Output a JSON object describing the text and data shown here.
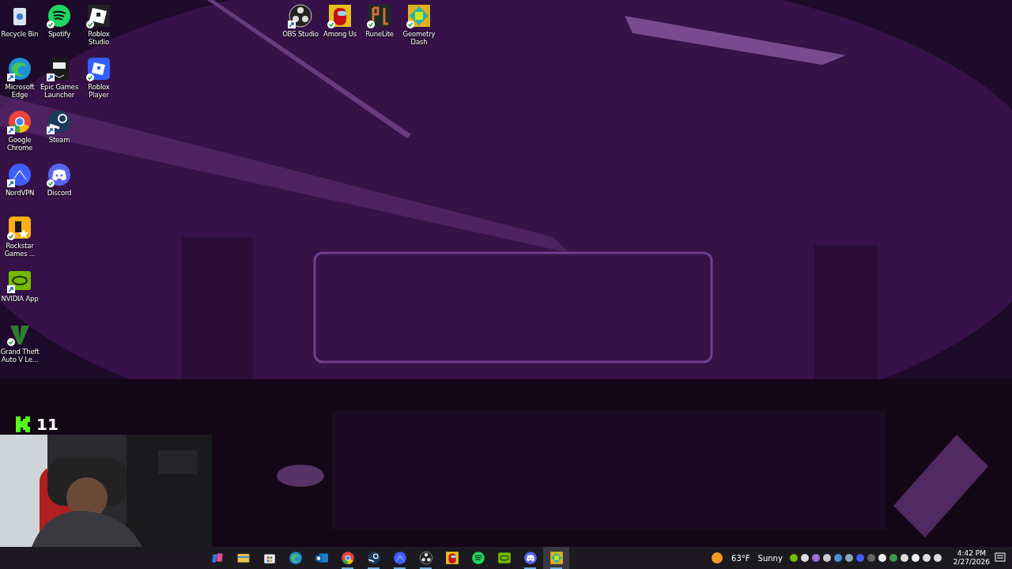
{
  "desktop": {
    "columns": [
      {
        "icons": [
          {
            "kind": "recycle",
            "label": "Recycle Bin",
            "shortcut": false,
            "synced": false
          },
          {
            "kind": "edge",
            "label": "Microsoft Edge",
            "shortcut": true,
            "synced": false
          },
          {
            "kind": "chrome",
            "label": "Google Chrome",
            "shortcut": true,
            "synced": false
          },
          {
            "kind": "nordvpn",
            "label": "NordVPN",
            "shortcut": true,
            "synced": false
          },
          {
            "kind": "rockstar",
            "label": "Rockstar Games ...",
            "shortcut": false,
            "synced": true
          },
          {
            "kind": "nvidia",
            "label": "NVIDIA App",
            "shortcut": true,
            "synced": false
          },
          {
            "kind": "gta",
            "label": "Grand Theft Auto V Le...",
            "shortcut": false,
            "synced": true
          }
        ]
      },
      {
        "icons": [
          {
            "kind": "spotify",
            "label": "Spotify",
            "shortcut": false,
            "synced": true
          },
          {
            "kind": "epic",
            "label": "Epic Games Launcher",
            "shortcut": true,
            "synced": false
          },
          {
            "kind": "steam",
            "label": "Steam",
            "shortcut": true,
            "synced": false
          },
          {
            "kind": "discord",
            "label": "Discord",
            "shortcut": false,
            "synced": true
          }
        ]
      },
      {
        "icons": [
          {
            "kind": "roblox",
            "label": "Roblox Studio",
            "shortcut": false,
            "synced": true
          },
          {
            "kind": "robloxplayer",
            "label": "Roblox Player",
            "shortcut": false,
            "synced": true
          }
        ]
      }
    ],
    "top_row": [
      {
        "kind": "obs",
        "label": "OBS Studio",
        "shortcut": true,
        "synced": false
      },
      {
        "kind": "amongus",
        "label": "Among Us",
        "shortcut": false,
        "synced": true
      },
      {
        "kind": "runelite",
        "label": "RuneLite",
        "shortcut": false,
        "synced": true
      },
      {
        "kind": "geometry",
        "label": "Geometry Dash",
        "shortcut": false,
        "synced": true
      }
    ]
  },
  "stream_overlay": {
    "kick_count": "11"
  },
  "taskbar": {
    "apps": [
      {
        "kind": "copilot",
        "running": false,
        "active": false
      },
      {
        "kind": "explorer",
        "running": false,
        "active": false
      },
      {
        "kind": "store",
        "running": false,
        "active": false
      },
      {
        "kind": "edge",
        "running": false,
        "active": false
      },
      {
        "kind": "outlook",
        "running": false,
        "active": false
      },
      {
        "kind": "chrome",
        "running": true,
        "active": false
      },
      {
        "kind": "steam",
        "running": true,
        "active": false
      },
      {
        "kind": "nordvpn",
        "running": true,
        "active": false
      },
      {
        "kind": "obs",
        "running": true,
        "active": false
      },
      {
        "kind": "amongus",
        "running": false,
        "active": false
      },
      {
        "kind": "spotify",
        "running": false,
        "active": false
      },
      {
        "kind": "nvidia",
        "running": false,
        "active": false
      },
      {
        "kind": "discord",
        "running": true,
        "active": false
      },
      {
        "kind": "geometry",
        "running": true,
        "active": true
      }
    ],
    "weather": {
      "temperature": "63°F",
      "condition": "Sunny"
    },
    "clock": {
      "time": "4:42 PM",
      "date": "2/27/2026"
    }
  }
}
